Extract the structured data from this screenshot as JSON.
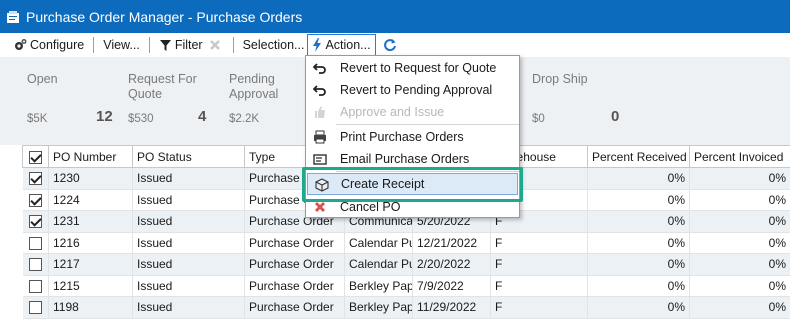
{
  "window": {
    "title": "Purchase Order Manager - Purchase Orders"
  },
  "toolbar": {
    "configure": "Configure",
    "view": "View...",
    "filter": "Filter",
    "selection": "Selection...",
    "action": "Action..."
  },
  "summary": [
    {
      "label": "Open",
      "amount": "$5K",
      "count": "12"
    },
    {
      "label": "Request For Quote",
      "amount": "$530",
      "count": "4"
    },
    {
      "label": "Pending Approval",
      "amount": "$2.2K",
      "count": ""
    },
    {
      "label": "Drop Ship",
      "amount": "$0",
      "count": "0"
    }
  ],
  "menu": {
    "items": [
      {
        "label": "Revert to Request for Quote",
        "icon": "undo-arrow-icon",
        "enabled": true
      },
      {
        "label": "Revert to Pending Approval",
        "icon": "undo-arrow-icon",
        "enabled": true
      },
      {
        "label": "Approve and Issue",
        "icon": "thumbs-up-icon",
        "enabled": false
      },
      {
        "label": "Print Purchase Orders",
        "icon": "printer-icon",
        "enabled": true
      },
      {
        "label": "Email Purchase Orders",
        "icon": "email-icon",
        "enabled": true
      },
      {
        "label": "Create Receipt",
        "icon": "package-box-icon",
        "enabled": true,
        "highlighted": true
      },
      {
        "label": "Cancel PO",
        "icon": "cancel-x-icon",
        "enabled": true
      }
    ]
  },
  "table": {
    "headers": [
      "PO Number",
      "PO Status",
      "Type",
      "",
      "",
      "Warehouse",
      "Percent Received",
      "Percent Invoiced"
    ],
    "rows": [
      {
        "checked": true,
        "po": "1230",
        "status": "Issued",
        "type": "Purchase Order",
        "vendor": "",
        "date": "",
        "warehouse": "",
        "received": "0%",
        "invoiced": "0%"
      },
      {
        "checked": true,
        "po": "1224",
        "status": "Issued",
        "type": "Purchase Order",
        "vendor": "",
        "date": "",
        "warehouse": "",
        "received": "0%",
        "invoiced": "0%"
      },
      {
        "checked": true,
        "po": "1231",
        "status": "Issued",
        "type": "Purchase Order",
        "vendor": "Communicati",
        "date": "5/20/2022",
        "warehouse": "F",
        "received": "0%",
        "invoiced": "0%"
      },
      {
        "checked": false,
        "po": "1216",
        "status": "Issued",
        "type": "Purchase Order",
        "vendor": "Calendar Publ",
        "date": "12/21/2022",
        "warehouse": "F",
        "received": "0%",
        "invoiced": "0%"
      },
      {
        "checked": false,
        "po": "1217",
        "status": "Issued",
        "type": "Purchase Order",
        "vendor": "Calendar Publ",
        "date": "2/20/2022",
        "warehouse": "F",
        "received": "0%",
        "invoiced": "0%"
      },
      {
        "checked": false,
        "po": "1215",
        "status": "Issued",
        "type": "Purchase Order",
        "vendor": "Berkley Paper",
        "date": "7/9/2022",
        "warehouse": "F",
        "received": "0%",
        "invoiced": "0%"
      },
      {
        "checked": false,
        "po": "1198",
        "status": "Issued",
        "type": "Purchase Order",
        "vendor": "Berkley Paper",
        "date": "11/29/2022",
        "warehouse": "F",
        "received": "0%",
        "invoiced": "0%"
      }
    ]
  },
  "colors": {
    "titlebar": "#0d6bbd",
    "highlight_frame": "#1fa88e",
    "summary_bg": "#eef1f4"
  }
}
